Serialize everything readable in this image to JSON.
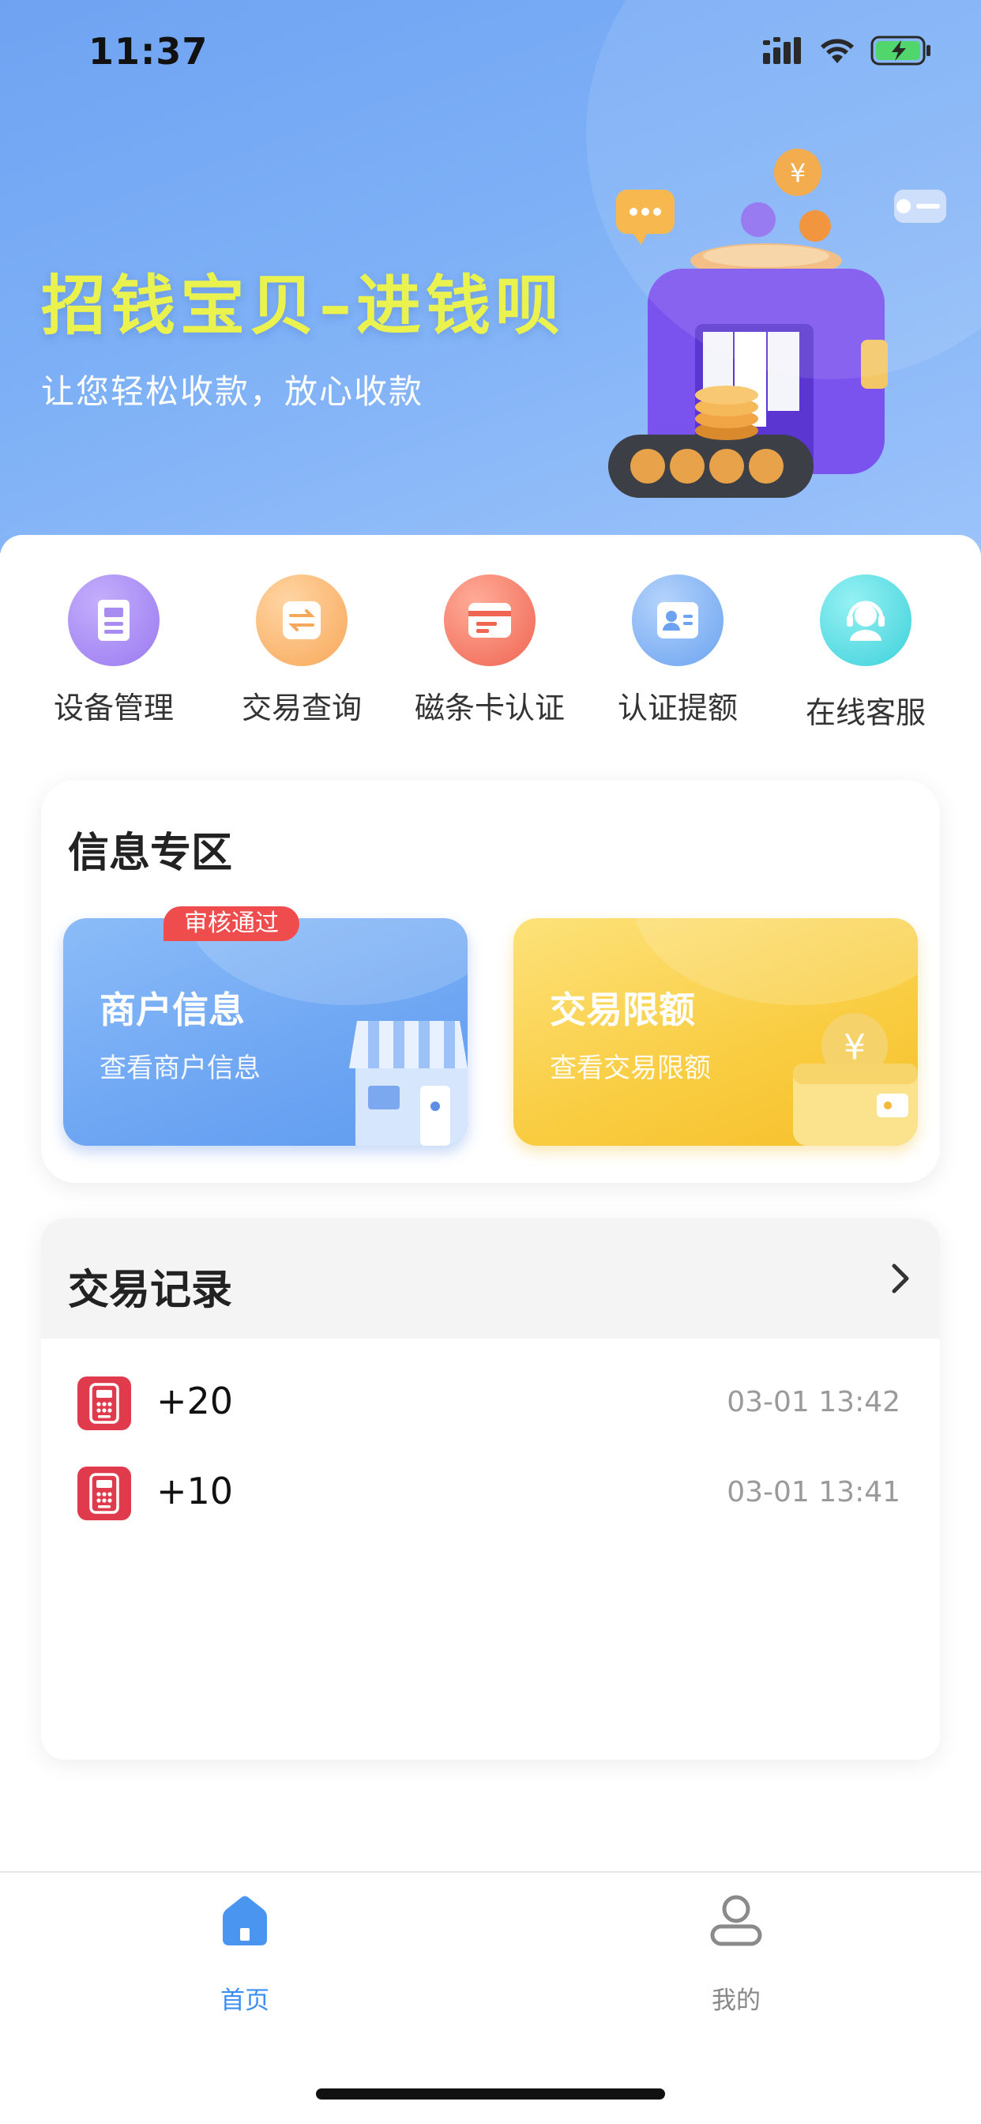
{
  "status_bar": {
    "time": "11:37"
  },
  "banner": {
    "title": "招钱宝贝–进钱呗",
    "subtitle": "让您轻松收款，放心收款"
  },
  "quick_actions": [
    {
      "label": "设备管理",
      "icon": "device-icon",
      "color": "#a78bf2"
    },
    {
      "label": "交易查询",
      "icon": "exchange-icon",
      "color": "#f8b06a"
    },
    {
      "label": "磁条卡认证",
      "icon": "card-icon",
      "color": "#f37560"
    },
    {
      "label": "认证提额",
      "icon": "id-card-icon",
      "color": "#6ca6f3"
    },
    {
      "label": "在线客服",
      "icon": "headset-icon",
      "color": "#4fd9e0"
    }
  ],
  "info_zone": {
    "title": "信息专区",
    "merchant": {
      "title": "商户信息",
      "subtitle": "查看商户信息",
      "badge": "审核通过"
    },
    "limit": {
      "title": "交易限额",
      "subtitle": "查看交易限额"
    }
  },
  "records": {
    "title": "交易记录",
    "items": [
      {
        "amount": "+20",
        "time": "03-01 13:42"
      },
      {
        "amount": "+10",
        "time": "03-01 13:41"
      }
    ]
  },
  "tabbar": {
    "home": {
      "label": "首页",
      "color": "#3b8ff0"
    },
    "mine": {
      "label": "我的",
      "color": "#888888"
    }
  },
  "colors": {
    "accent": "#3b8ff0",
    "banner_title": "#e9f24e",
    "badge": "#ef4d4d",
    "record_icon": "#e03a4d"
  }
}
